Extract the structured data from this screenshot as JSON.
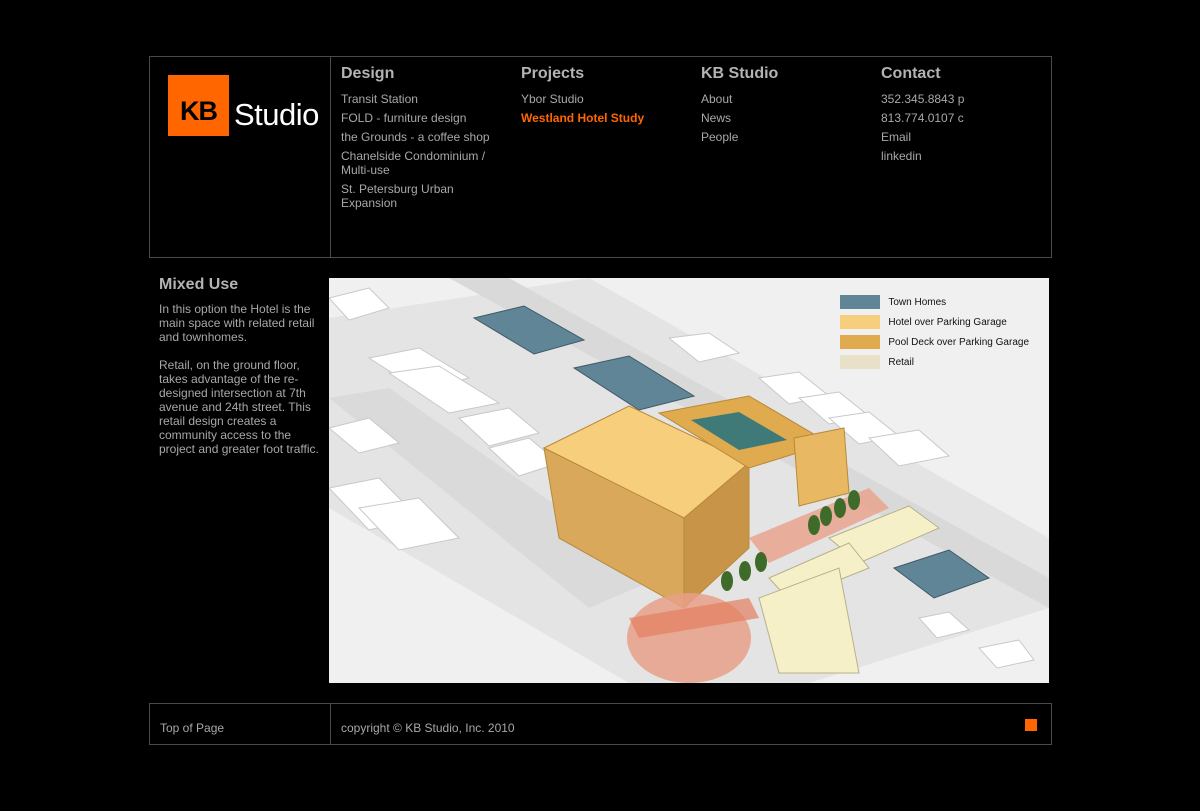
{
  "logo": {
    "mark": "KB",
    "word": "Studio"
  },
  "nav": {
    "design": {
      "heading": "Design",
      "items": [
        "Transit Station",
        "FOLD - furniture design",
        "the Grounds - a coffee shop",
        "Chanelside Condominium / Multi-use",
        "St. Petersburg Urban Expansion"
      ]
    },
    "projects": {
      "heading": "Projects",
      "items": [
        "Ybor Studio",
        "Westland Hotel Study"
      ]
    },
    "studio": {
      "heading": "KB Studio",
      "items": [
        "About",
        "News",
        "People"
      ]
    },
    "contact": {
      "heading": "Contact",
      "items": [
        "352.345.8843 p",
        "813.774.0107 c",
        "Email",
        "linkedin"
      ]
    }
  },
  "main": {
    "title": "Mixed Use",
    "paragraphs": [
      "In this option the Hotel is the main space with related retail and townhomes.",
      "Retail, on the ground floor, takes advantage of the re-designed intersection at 7th avenue and 24th street. This retail design creates a community access to the project and greater foot traffic."
    ]
  },
  "legend": [
    {
      "label": "Town Homes",
      "color": "#5f8596"
    },
    {
      "label": "Hotel over Parking Garage",
      "color": "#f7ce7c"
    },
    {
      "label": "Pool Deck over Parking Garage",
      "color": "#e0aa4e"
    },
    {
      "label": "Retail",
      "color": "#e8e1c8"
    }
  ],
  "footer": {
    "top_link": "Top of Page",
    "copyright": "copyright © KB Studio, Inc. 2010"
  },
  "colors": {
    "accent": "#ff6600",
    "background": "#000000",
    "border": "#4a4a4a",
    "text": "#a8a8a8"
  }
}
